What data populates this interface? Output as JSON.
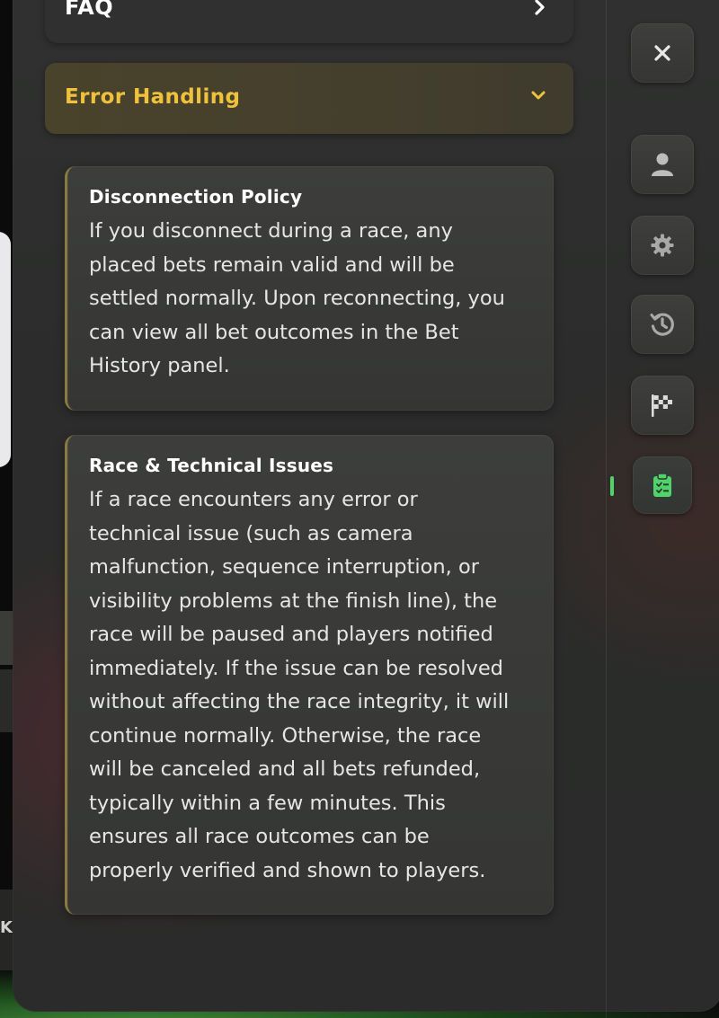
{
  "faq": {
    "label": "FAQ",
    "chevron_icon": "chevron-right-icon"
  },
  "error_handling": {
    "label": "Error Handling",
    "chevron_icon": "chevron-down-icon",
    "accent_color": "#f0c23c"
  },
  "sections": [
    {
      "title": "Disconnection Policy",
      "lines": [
        "If you disconnect during a race, any",
        "placed bets remain valid and will be",
        "settled normally. Upon reconnecting, you",
        "can view all bet outcomes in the Bet",
        "History panel."
      ]
    },
    {
      "title": "Race & Technical Issues",
      "lines": [
        "If a race encounters any error or",
        "technical issue (such as camera",
        "malfunction, sequence interruption, or",
        "visibility problems at the finish line), the",
        "race will be paused and players notified",
        "immediately. If the issue can be resolved",
        "without affecting the race integrity, it will",
        "continue normally. Otherwise, the race",
        "will be canceled and all bets refunded,",
        "typically within a few minutes. This",
        "ensures all race outcomes can be",
        "properly verified and shown to players."
      ]
    }
  ],
  "sidebar": {
    "buttons": [
      "close-icon",
      "user-icon",
      "gear-icon",
      "history-icon",
      "checkered-flag-icon",
      "clipboard-icon"
    ],
    "active": "clipboard-icon",
    "active_color": "#4fd36a"
  },
  "background": {
    "partial_letter": "K"
  }
}
